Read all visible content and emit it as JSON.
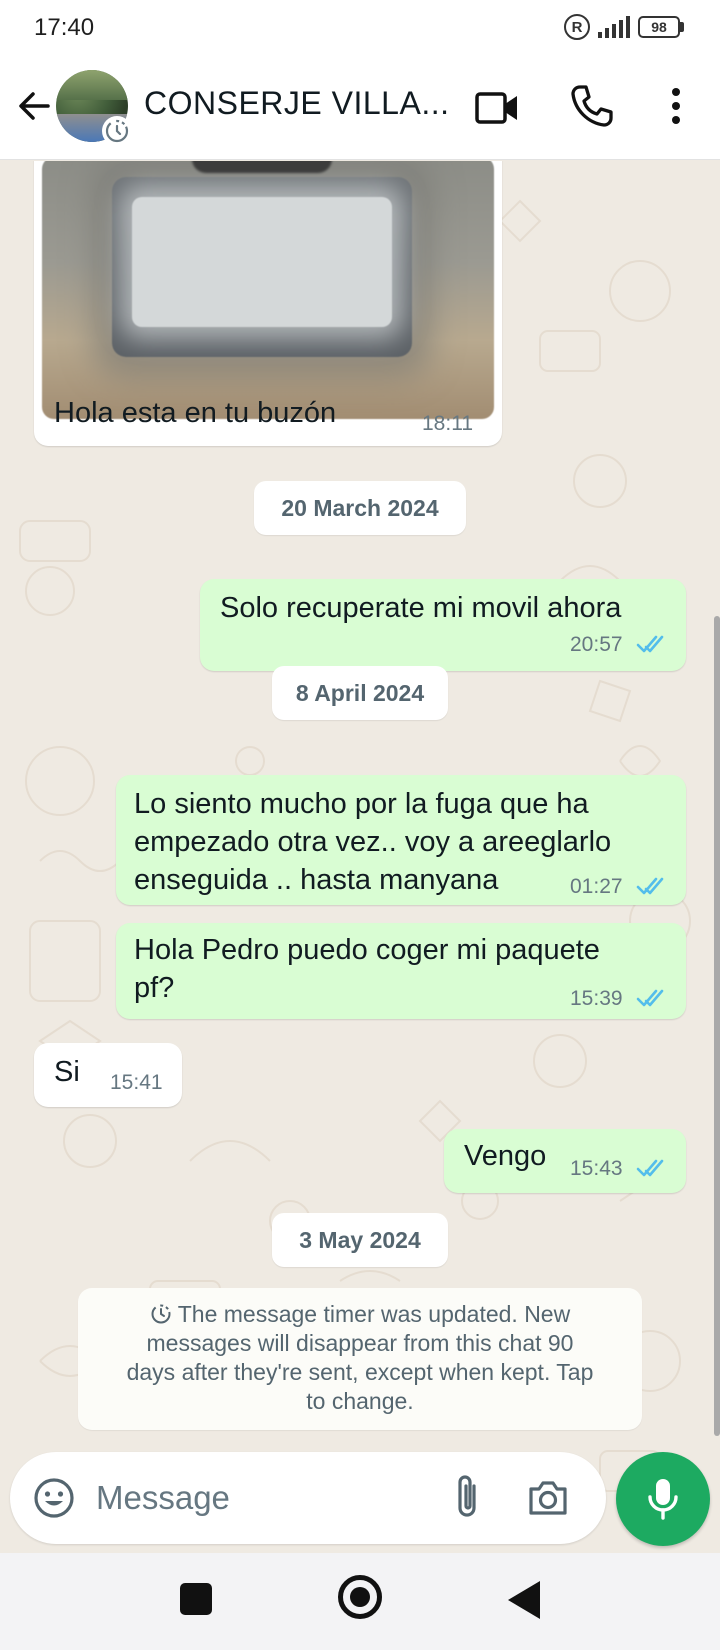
{
  "status_bar": {
    "time": "17:40",
    "registered_symbol": "R",
    "battery": "98"
  },
  "header": {
    "contact_name": "CONSERJE VILLA...",
    "icons": [
      "back-arrow-icon",
      "disappearing-timer-icon",
      "video-call-icon",
      "phone-icon",
      "more-vert-icon"
    ]
  },
  "messages": [
    {
      "id": "m1",
      "direction": "incoming",
      "has_image": true,
      "text": "Hola esta en tu buzón",
      "time": "18:11"
    },
    {
      "date_chip": "20 March 2024"
    },
    {
      "id": "m2",
      "direction": "outgoing",
      "text": "Solo recuperate mi movil ahora",
      "time": "20:57",
      "status": "read"
    },
    {
      "date_chip": "8 April 2024"
    },
    {
      "id": "m3",
      "direction": "outgoing",
      "lines": [
        "Lo siento mucho por la fuga que ha",
        "empezado otra vez.. voy a areeglarlo",
        "enseguida .. hasta manyana"
      ],
      "time": "01:27",
      "status": "read"
    },
    {
      "id": "m4",
      "direction": "outgoing",
      "lines": [
        "Hola Pedro puedo coger mi paquete",
        "pf?"
      ],
      "time": "15:39",
      "status": "read"
    },
    {
      "id": "m5",
      "direction": "incoming",
      "text": "Si",
      "time": "15:41"
    },
    {
      "id": "m6",
      "direction": "outgoing",
      "text": "Vengo",
      "time": "15:43",
      "status": "read"
    },
    {
      "date_chip": "3 May 2024"
    }
  ],
  "system_notice": {
    "lines": [
      "The message timer was updated. New",
      "messages will disappear from this chat 90",
      "days after they're sent, except when kept. Tap",
      "to change."
    ]
  },
  "composer": {
    "placeholder": "Message"
  },
  "colors": {
    "outgoing_bubble": "#d9fdd3",
    "incoming_bubble": "#ffffff",
    "chat_background": "#efeae2",
    "read_tick": "#53bdeb",
    "mic_button": "#1daa61"
  }
}
